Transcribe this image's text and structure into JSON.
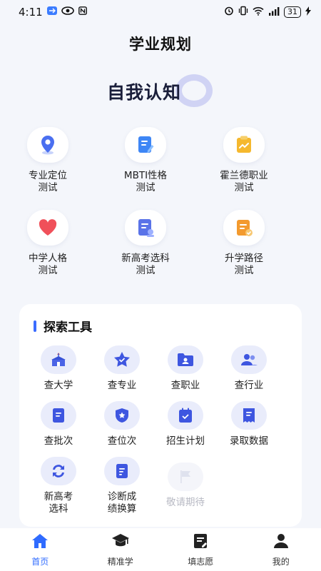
{
  "status_bar": {
    "time": "4:11",
    "battery": "31"
  },
  "page": {
    "title": "学业规划"
  },
  "self_section": {
    "banner": "自我认知",
    "items": [
      {
        "label_line1": "专业定位",
        "label_line2": "测试",
        "icon": "location-pin-icon",
        "color": "#4a6ff0"
      },
      {
        "label_line1": "MBTI性格",
        "label_line2": "测试",
        "icon": "document-edit-icon",
        "color": "#3e86f5"
      },
      {
        "label_line1": "霍兰德职业",
        "label_line2": "测试",
        "icon": "chart-clipboard-icon",
        "color": "#f5b82e"
      },
      {
        "label_line1": "中学人格",
        "label_line2": "测试",
        "icon": "heart-icon",
        "color": "#f0505a"
      },
      {
        "label_line1": "新高考选科",
        "label_line2": "测试",
        "icon": "profile-card-icon",
        "color": "#5a73e8"
      },
      {
        "label_line1": "升学路径",
        "label_line2": "测试",
        "icon": "checklist-icon",
        "color": "#f39a2e"
      }
    ]
  },
  "explore": {
    "title": "探索工具",
    "tools": [
      {
        "line1": "查大学",
        "line2": "",
        "icon": "university-icon"
      },
      {
        "line1": "查专业",
        "line2": "",
        "icon": "star-badge-icon"
      },
      {
        "line1": "查职业",
        "line2": "",
        "icon": "id-folder-icon"
      },
      {
        "line1": "查行业",
        "line2": "",
        "icon": "people-icon"
      },
      {
        "line1": "查批次",
        "line2": "",
        "icon": "document-icon"
      },
      {
        "line1": "查位次",
        "line2": "",
        "icon": "shield-star-icon"
      },
      {
        "line1": "招生计划",
        "line2": "",
        "icon": "calendar-check-icon"
      },
      {
        "line1": "录取数据",
        "line2": "",
        "icon": "receipt-icon"
      },
      {
        "line1": "新高考",
        "line2": "选科",
        "icon": "refresh-icon"
      },
      {
        "line1": "诊断成",
        "line2": "绩换算",
        "icon": "report-icon"
      },
      {
        "line1": "敬请期待",
        "line2": "",
        "icon": "flag-icon"
      }
    ]
  },
  "nav": {
    "items": [
      {
        "label": "首页",
        "icon": "home-icon"
      },
      {
        "label": "精准学",
        "icon": "graduation-cap-icon"
      },
      {
        "label": "填志愿",
        "icon": "form-icon"
      },
      {
        "label": "我的",
        "icon": "user-icon"
      }
    ],
    "active_color": "#2f6bff"
  }
}
